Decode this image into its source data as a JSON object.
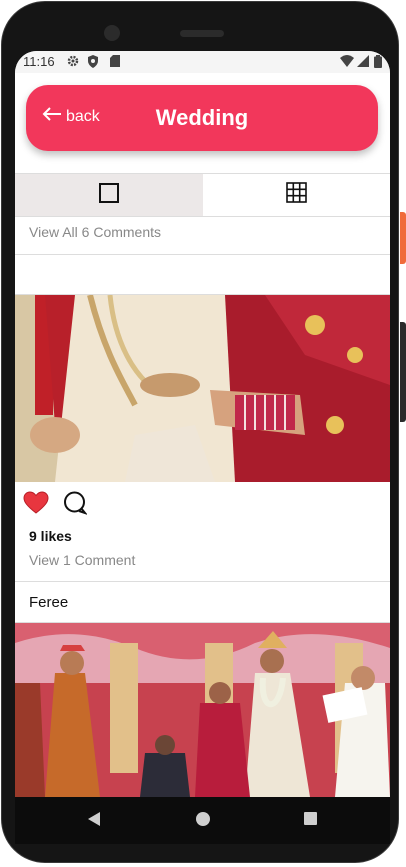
{
  "status": {
    "time": "11:16"
  },
  "header": {
    "back_label": "back",
    "title": "Wedding",
    "color": "#f2375b"
  },
  "tabs": [
    {
      "icon": "square-icon"
    },
    {
      "icon": "grid-icon"
    }
  ],
  "post1": {
    "comments_link": "View All 6 Comments"
  },
  "post2": {
    "likes": "9 likes",
    "comments_link": "View 1 Comment",
    "liked": true
  },
  "post3": {
    "username": "Feree"
  }
}
